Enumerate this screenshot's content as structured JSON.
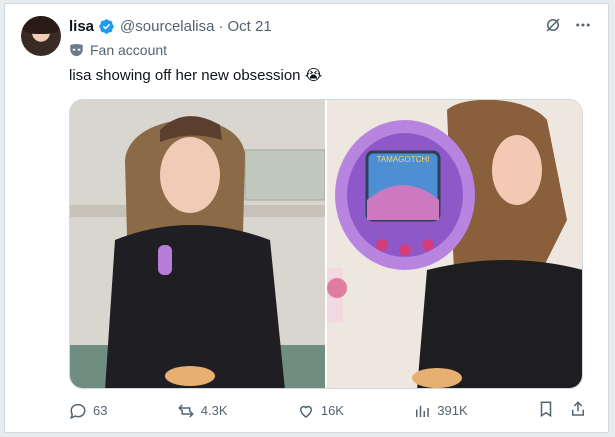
{
  "author": {
    "name": "lisa",
    "handle": "@sourcelalisa",
    "separator": "·",
    "date": "Oct 21",
    "label": "Fan account"
  },
  "tweet": {
    "text": "lisa showing off her new obsession 😭"
  },
  "media": {
    "count": 2,
    "screen_text": "TAMAGOTCHI"
  },
  "stats": {
    "replies": "63",
    "reposts": "4.3K",
    "likes": "16K",
    "views": "391K"
  },
  "colors": {
    "verified": "#1d9bf0",
    "text_secondary": "#536471"
  }
}
